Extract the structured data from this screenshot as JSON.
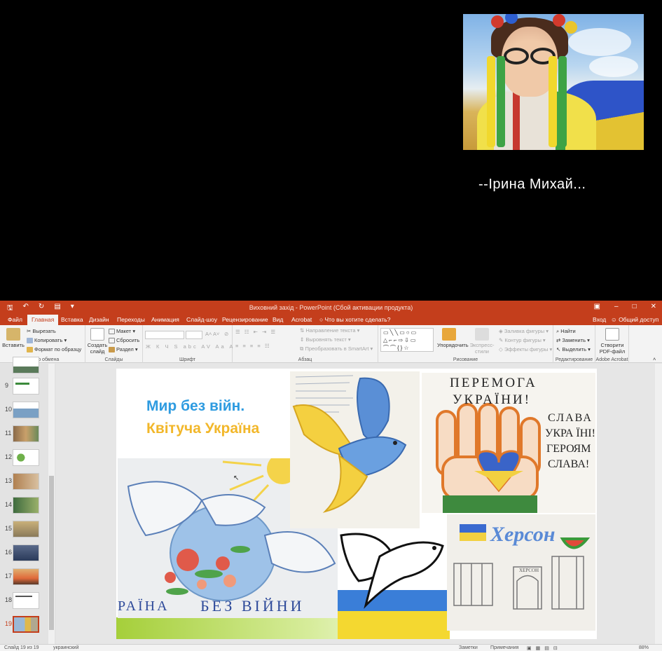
{
  "caller": {
    "name": "--Ірина Михай..."
  },
  "ppt": {
    "window_title": "Виховний захід - PowerPoint (Сбой активации продукта)",
    "tabs": [
      "Файл",
      "Главная",
      "Вставка",
      "Дизайн",
      "Переходы",
      "Анимация",
      "Слайд-шоу",
      "Рецензирование",
      "Вид",
      "Acrobat"
    ],
    "active_tab": "Главная",
    "tell_me": "Что вы хотите сделать?",
    "sign_in": "Вход",
    "share": "Общий доступ",
    "ribbon": {
      "clipboard": {
        "paste": "Вставить",
        "cut": "Вырезать",
        "copy": "Копировать",
        "format_painter": "Формат по образцу",
        "label": "Буфер обмена"
      },
      "slides": {
        "new_slide": "Создать слайд",
        "layout": "Макет",
        "reset": "Сбросить",
        "section": "Раздел",
        "label": "Слайды"
      },
      "font": {
        "label": "Шрифт"
      },
      "paragraph": {
        "text_direction": "Направление текста",
        "align_text": "Выровнять текст",
        "smartart": "Преобразовать в SmartArt",
        "label": "Абзац"
      },
      "drawing": {
        "arrange": "Упорядочить",
        "quick_styles": "Экспресс-стили",
        "fill": "Заливка фигуры",
        "outline": "Контур фигуры",
        "effects": "Эффекты фигуры",
        "label": "Рисование"
      },
      "editing": {
        "find": "Найти",
        "replace": "Заменить",
        "select": "Выделить",
        "label": "Редактирование"
      },
      "acrobat": {
        "create_pdf": "Створити PDF-файл",
        "label": "Adobe Acrobat"
      }
    },
    "thumbnails": [
      "9",
      "10",
      "11",
      "12",
      "13",
      "14",
      "15",
      "16",
      "17",
      "18",
      "19"
    ],
    "active_slide": "19",
    "slide": {
      "title_line1": "Мир без війн.",
      "title_line2": "Квітуча Україна"
    },
    "drawings": {
      "peremoga_l1": "ПЕРЕМОГА",
      "peremoga_l2": "УКРАЇНИ!",
      "slava_l1": "СЛАВА",
      "slava_l2": "УКРА ЇНІ!",
      "slava_l3": "ГЕРОЯМ",
      "slava_l4": "СЛАВА!",
      "kherson": "Херсон",
      "bez_viiny": "БЕЗ ВІЙНИ",
      "raina": "РАЇНА",
      "kherson_sign": "ХЕРСОН"
    },
    "status": {
      "slide_info": "Слайд 19 из 19",
      "language": "украинский",
      "notes": "Заметки",
      "comments": "Примечания",
      "zoom": "88%"
    }
  }
}
